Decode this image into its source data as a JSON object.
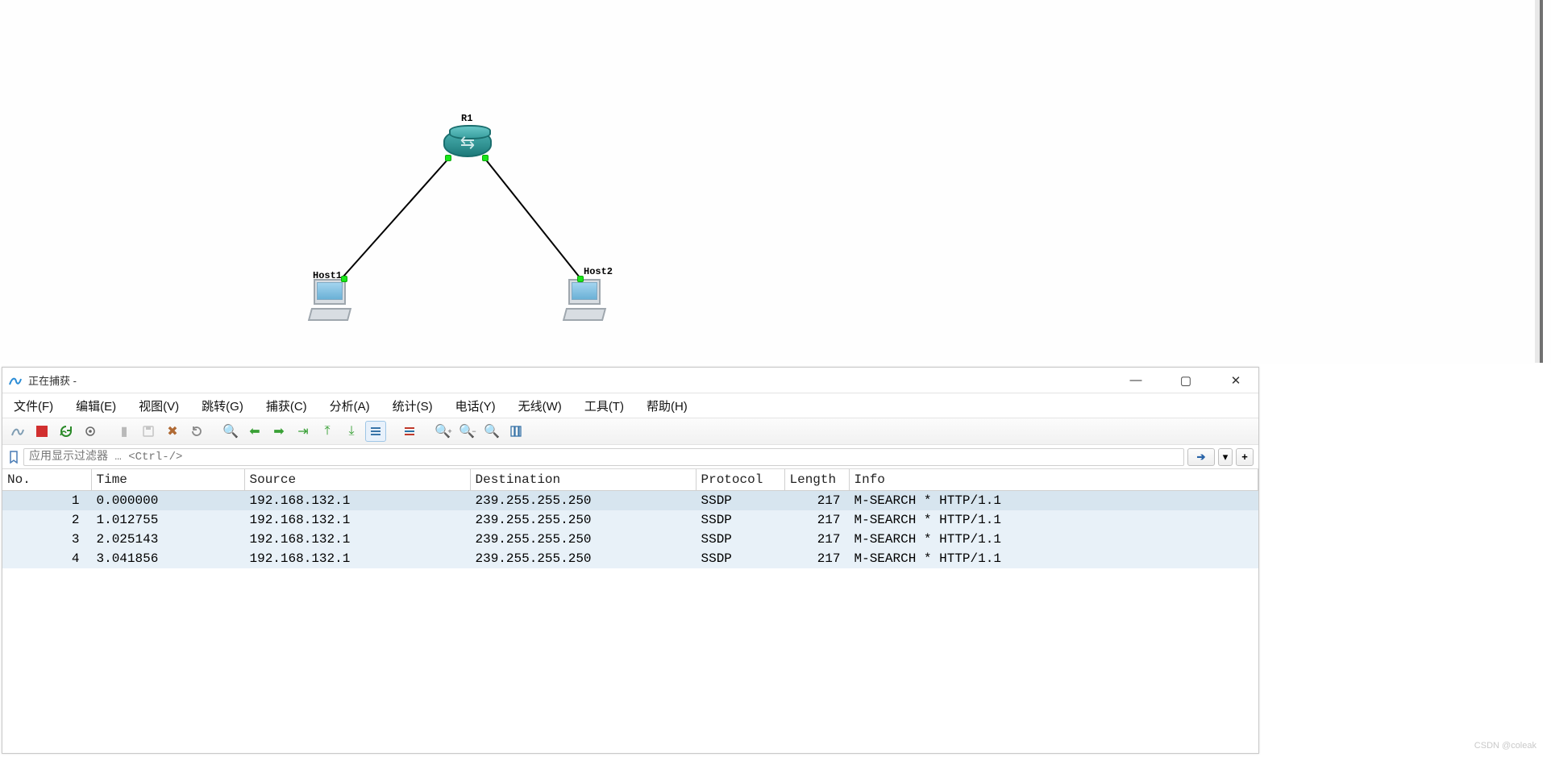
{
  "topo": {
    "router_label": "R1",
    "host1_label": "Host1",
    "host2_label": "Host2"
  },
  "ws_window": {
    "title": "正在捕获 -",
    "min_label": "—",
    "max_label": "▢",
    "close_label": "✕"
  },
  "menubar": [
    "文件(F)",
    "编辑(E)",
    "视图(V)",
    "跳转(G)",
    "捕获(C)",
    "分析(A)",
    "统计(S)",
    "电话(Y)",
    "无线(W)",
    "工具(T)",
    "帮助(H)"
  ],
  "filter": {
    "placeholder": "应用显示过滤器 … <Ctrl-/>",
    "dropdown_label": "▾",
    "plus_label": "+"
  },
  "columns": {
    "no": "No.",
    "time": "Time",
    "source": "Source",
    "destination": "Destination",
    "protocol": "Protocol",
    "length": "Length",
    "info": "Info"
  },
  "packets": [
    {
      "no": "1",
      "time": "0.000000",
      "src": "192.168.132.1",
      "dst": "239.255.255.250",
      "proto": "SSDP",
      "len": "217",
      "info": "M-SEARCH * HTTP/1.1",
      "sel": true
    },
    {
      "no": "2",
      "time": "1.012755",
      "src": "192.168.132.1",
      "dst": "239.255.255.250",
      "proto": "SSDP",
      "len": "217",
      "info": "M-SEARCH * HTTP/1.1",
      "sel": false
    },
    {
      "no": "3",
      "time": "2.025143",
      "src": "192.168.132.1",
      "dst": "239.255.255.250",
      "proto": "SSDP",
      "len": "217",
      "info": "M-SEARCH * HTTP/1.1",
      "sel": false
    },
    {
      "no": "4",
      "time": "3.041856",
      "src": "192.168.132.1",
      "dst": "239.255.255.250",
      "proto": "SSDP",
      "len": "217",
      "info": "M-SEARCH * HTTP/1.1",
      "sel": false
    }
  ],
  "watermark": "CSDN @coleak"
}
